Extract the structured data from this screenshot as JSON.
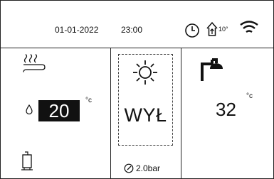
{
  "header": {
    "date": "01-01-2022",
    "time": "23:00",
    "outdoor_temp": "10°"
  },
  "heating": {
    "setpoint_value": "20",
    "setpoint_unit": "°c"
  },
  "mode": {
    "state_label": "WYŁ",
    "pressure": "2.0bar"
  },
  "dhw": {
    "temperature": "32",
    "unit": "°c"
  },
  "icons": {
    "header": [
      "clock-icon",
      "house-outdoor-temp-icon",
      "wifi-icon"
    ],
    "heating": [
      "underfloor-heating-icon",
      "water-drop-icon",
      "boiler-tank-icon"
    ],
    "mode": [
      "sun-icon",
      "pressure-gauge-icon"
    ],
    "dhw": [
      "shower-icon"
    ]
  }
}
